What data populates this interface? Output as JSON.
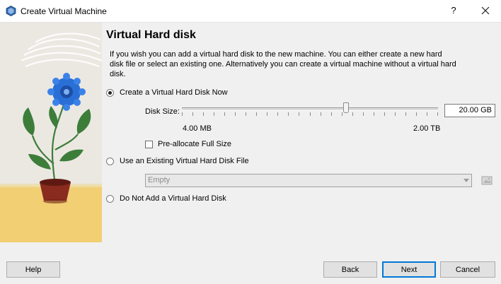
{
  "window": {
    "title": "Create Virtual Machine",
    "help_glyph": "?"
  },
  "page": {
    "heading": "Virtual Hard disk",
    "description": "If you wish you can add a virtual hard disk to the new machine. You can either create a new hard disk file or select an existing one. Alternatively you can create a virtual machine without a virtual hard disk."
  },
  "options": {
    "create_now": {
      "label": "Create a Virtual Hard Disk Now",
      "selected": true
    },
    "use_existing": {
      "label": "Use an Existing Virtual Hard Disk File",
      "selected": false
    },
    "no_disk": {
      "label": "Do Not Add a Virtual Hard Disk",
      "selected": false
    }
  },
  "disk_size": {
    "label": "Disk Size:",
    "value": "20.00 GB",
    "min_label": "4.00 MB",
    "max_label": "2.00 TB",
    "slider_fraction": 0.64
  },
  "preallocate": {
    "label": "Pre-allocate Full Size",
    "checked": false
  },
  "existing_file": {
    "selected_value": "Empty"
  },
  "buttons": {
    "help": "Help",
    "back": "Back",
    "next": "Next",
    "cancel": "Cancel"
  },
  "colors": {
    "accent": "#0078d7",
    "flower_blue": "#2a6fd6",
    "leaf_green": "#3c7d3a",
    "pot_red": "#8a2b1f",
    "table_yellow": "#f1cf72"
  }
}
